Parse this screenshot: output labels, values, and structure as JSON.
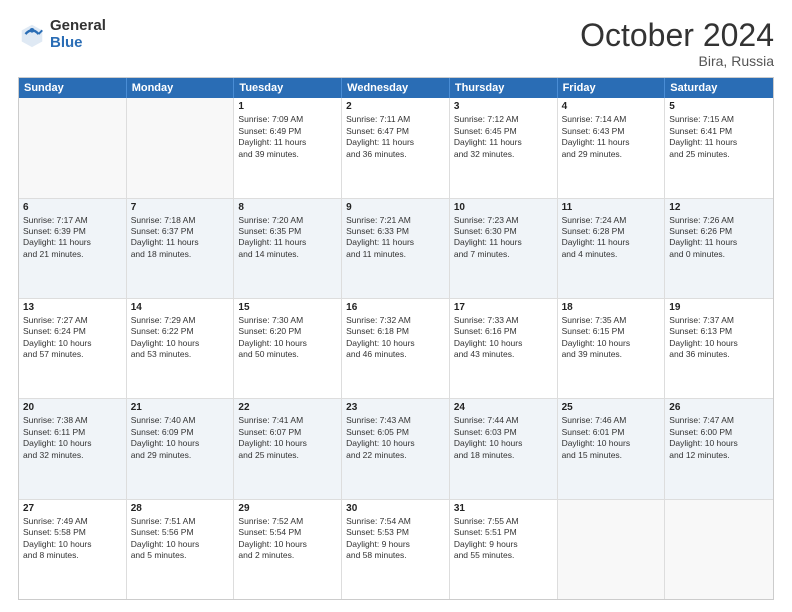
{
  "logo": {
    "general": "General",
    "blue": "Blue"
  },
  "title": "October 2024",
  "location": "Bira, Russia",
  "weekdays": [
    "Sunday",
    "Monday",
    "Tuesday",
    "Wednesday",
    "Thursday",
    "Friday",
    "Saturday"
  ],
  "rows": [
    [
      {
        "day": "",
        "lines": [],
        "empty": true
      },
      {
        "day": "",
        "lines": [],
        "empty": true
      },
      {
        "day": "1",
        "lines": [
          "Sunrise: 7:09 AM",
          "Sunset: 6:49 PM",
          "Daylight: 11 hours",
          "and 39 minutes."
        ]
      },
      {
        "day": "2",
        "lines": [
          "Sunrise: 7:11 AM",
          "Sunset: 6:47 PM",
          "Daylight: 11 hours",
          "and 36 minutes."
        ]
      },
      {
        "day": "3",
        "lines": [
          "Sunrise: 7:12 AM",
          "Sunset: 6:45 PM",
          "Daylight: 11 hours",
          "and 32 minutes."
        ]
      },
      {
        "day": "4",
        "lines": [
          "Sunrise: 7:14 AM",
          "Sunset: 6:43 PM",
          "Daylight: 11 hours",
          "and 29 minutes."
        ]
      },
      {
        "day": "5",
        "lines": [
          "Sunrise: 7:15 AM",
          "Sunset: 6:41 PM",
          "Daylight: 11 hours",
          "and 25 minutes."
        ]
      }
    ],
    [
      {
        "day": "6",
        "lines": [
          "Sunrise: 7:17 AM",
          "Sunset: 6:39 PM",
          "Daylight: 11 hours",
          "and 21 minutes."
        ]
      },
      {
        "day": "7",
        "lines": [
          "Sunrise: 7:18 AM",
          "Sunset: 6:37 PM",
          "Daylight: 11 hours",
          "and 18 minutes."
        ]
      },
      {
        "day": "8",
        "lines": [
          "Sunrise: 7:20 AM",
          "Sunset: 6:35 PM",
          "Daylight: 11 hours",
          "and 14 minutes."
        ]
      },
      {
        "day": "9",
        "lines": [
          "Sunrise: 7:21 AM",
          "Sunset: 6:33 PM",
          "Daylight: 11 hours",
          "and 11 minutes."
        ]
      },
      {
        "day": "10",
        "lines": [
          "Sunrise: 7:23 AM",
          "Sunset: 6:30 PM",
          "Daylight: 11 hours",
          "and 7 minutes."
        ]
      },
      {
        "day": "11",
        "lines": [
          "Sunrise: 7:24 AM",
          "Sunset: 6:28 PM",
          "Daylight: 11 hours",
          "and 4 minutes."
        ]
      },
      {
        "day": "12",
        "lines": [
          "Sunrise: 7:26 AM",
          "Sunset: 6:26 PM",
          "Daylight: 11 hours",
          "and 0 minutes."
        ]
      }
    ],
    [
      {
        "day": "13",
        "lines": [
          "Sunrise: 7:27 AM",
          "Sunset: 6:24 PM",
          "Daylight: 10 hours",
          "and 57 minutes."
        ]
      },
      {
        "day": "14",
        "lines": [
          "Sunrise: 7:29 AM",
          "Sunset: 6:22 PM",
          "Daylight: 10 hours",
          "and 53 minutes."
        ]
      },
      {
        "day": "15",
        "lines": [
          "Sunrise: 7:30 AM",
          "Sunset: 6:20 PM",
          "Daylight: 10 hours",
          "and 50 minutes."
        ]
      },
      {
        "day": "16",
        "lines": [
          "Sunrise: 7:32 AM",
          "Sunset: 6:18 PM",
          "Daylight: 10 hours",
          "and 46 minutes."
        ]
      },
      {
        "day": "17",
        "lines": [
          "Sunrise: 7:33 AM",
          "Sunset: 6:16 PM",
          "Daylight: 10 hours",
          "and 43 minutes."
        ]
      },
      {
        "day": "18",
        "lines": [
          "Sunrise: 7:35 AM",
          "Sunset: 6:15 PM",
          "Daylight: 10 hours",
          "and 39 minutes."
        ]
      },
      {
        "day": "19",
        "lines": [
          "Sunrise: 7:37 AM",
          "Sunset: 6:13 PM",
          "Daylight: 10 hours",
          "and 36 minutes."
        ]
      }
    ],
    [
      {
        "day": "20",
        "lines": [
          "Sunrise: 7:38 AM",
          "Sunset: 6:11 PM",
          "Daylight: 10 hours",
          "and 32 minutes."
        ]
      },
      {
        "day": "21",
        "lines": [
          "Sunrise: 7:40 AM",
          "Sunset: 6:09 PM",
          "Daylight: 10 hours",
          "and 29 minutes."
        ]
      },
      {
        "day": "22",
        "lines": [
          "Sunrise: 7:41 AM",
          "Sunset: 6:07 PM",
          "Daylight: 10 hours",
          "and 25 minutes."
        ]
      },
      {
        "day": "23",
        "lines": [
          "Sunrise: 7:43 AM",
          "Sunset: 6:05 PM",
          "Daylight: 10 hours",
          "and 22 minutes."
        ]
      },
      {
        "day": "24",
        "lines": [
          "Sunrise: 7:44 AM",
          "Sunset: 6:03 PM",
          "Daylight: 10 hours",
          "and 18 minutes."
        ]
      },
      {
        "day": "25",
        "lines": [
          "Sunrise: 7:46 AM",
          "Sunset: 6:01 PM",
          "Daylight: 10 hours",
          "and 15 minutes."
        ]
      },
      {
        "day": "26",
        "lines": [
          "Sunrise: 7:47 AM",
          "Sunset: 6:00 PM",
          "Daylight: 10 hours",
          "and 12 minutes."
        ]
      }
    ],
    [
      {
        "day": "27",
        "lines": [
          "Sunrise: 7:49 AM",
          "Sunset: 5:58 PM",
          "Daylight: 10 hours",
          "and 8 minutes."
        ]
      },
      {
        "day": "28",
        "lines": [
          "Sunrise: 7:51 AM",
          "Sunset: 5:56 PM",
          "Daylight: 10 hours",
          "and 5 minutes."
        ]
      },
      {
        "day": "29",
        "lines": [
          "Sunrise: 7:52 AM",
          "Sunset: 5:54 PM",
          "Daylight: 10 hours",
          "and 2 minutes."
        ]
      },
      {
        "day": "30",
        "lines": [
          "Sunrise: 7:54 AM",
          "Sunset: 5:53 PM",
          "Daylight: 9 hours",
          "and 58 minutes."
        ]
      },
      {
        "day": "31",
        "lines": [
          "Sunrise: 7:55 AM",
          "Sunset: 5:51 PM",
          "Daylight: 9 hours",
          "and 55 minutes."
        ]
      },
      {
        "day": "",
        "lines": [],
        "empty": true
      },
      {
        "day": "",
        "lines": [],
        "empty": true
      }
    ]
  ]
}
